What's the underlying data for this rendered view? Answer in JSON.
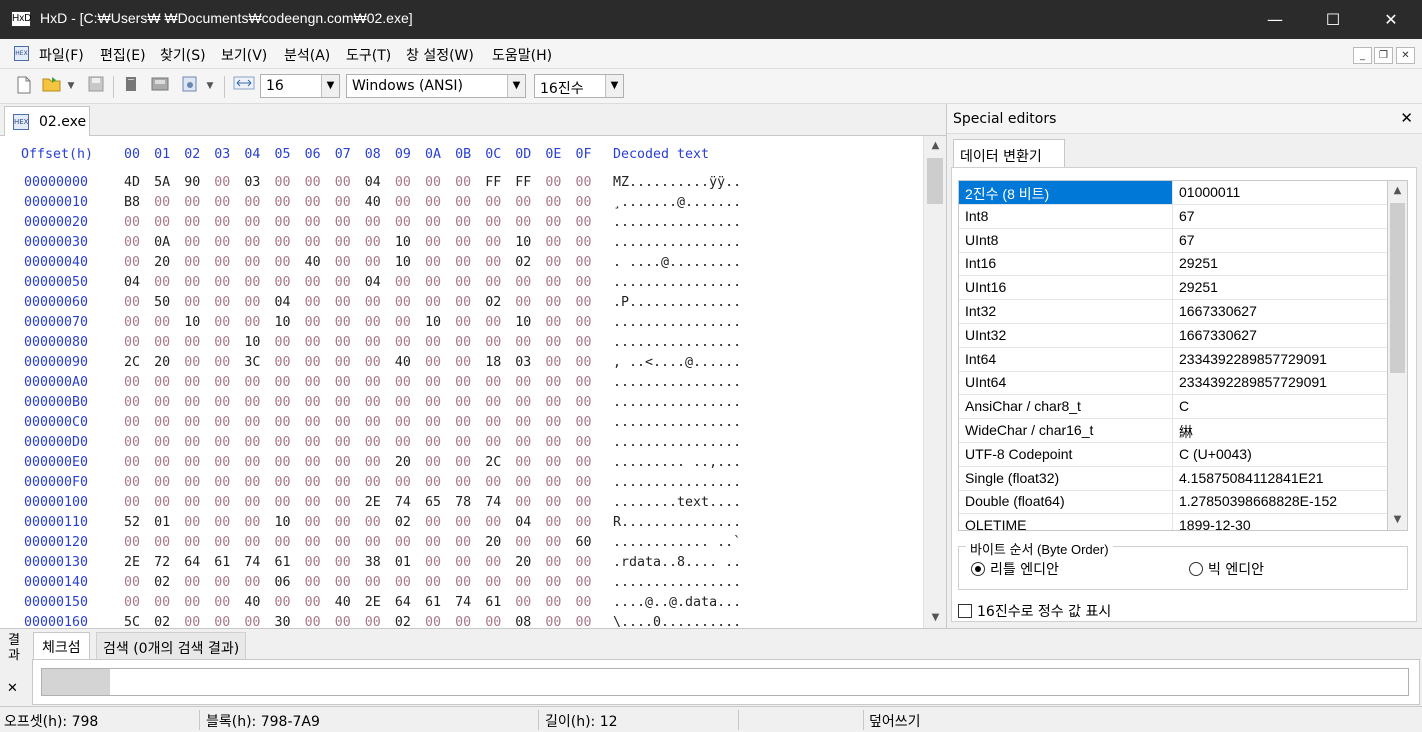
{
  "window": {
    "app_icon": "HxD",
    "title": "HxD - [C:₩Users₩     ₩Documents₩codeengn.com₩02.exe]",
    "minimize": "—",
    "maximize": "☐",
    "close": "✕"
  },
  "menu": [
    "파일(F)",
    "편집(E)",
    "찾기(S)",
    "보기(V)",
    "분석(A)",
    "도구(T)",
    "창 설정(W)",
    "도움말(H)"
  ],
  "toolbar": {
    "bytes_per_row": "16",
    "encoding": "Windows (ANSI)",
    "number_base": "16진수"
  },
  "document_tab": {
    "icon": "HEX",
    "label": "02.exe"
  },
  "hex": {
    "header_offset": "Offset(h)",
    "header_cols": [
      "00",
      "01",
      "02",
      "03",
      "04",
      "05",
      "06",
      "07",
      "08",
      "09",
      "0A",
      "0B",
      "0C",
      "0D",
      "0E",
      "0F"
    ],
    "header_text": "Decoded text",
    "rows": [
      {
        "off": "00000000",
        "bytes": [
          "4D",
          "5A",
          "90",
          "00",
          "03",
          "00",
          "00",
          "00",
          "04",
          "00",
          "00",
          "00",
          "FF",
          "FF",
          "00",
          "00"
        ],
        "text": "MZ..........ÿÿ.."
      },
      {
        "off": "00000010",
        "bytes": [
          "B8",
          "00",
          "00",
          "00",
          "00",
          "00",
          "00",
          "00",
          "40",
          "00",
          "00",
          "00",
          "00",
          "00",
          "00",
          "00"
        ],
        "text": "¸.......@......."
      },
      {
        "off": "00000020",
        "bytes": [
          "00",
          "00",
          "00",
          "00",
          "00",
          "00",
          "00",
          "00",
          "00",
          "00",
          "00",
          "00",
          "00",
          "00",
          "00",
          "00"
        ],
        "text": "................"
      },
      {
        "off": "00000030",
        "bytes": [
          "00",
          "0A",
          "00",
          "00",
          "00",
          "00",
          "00",
          "00",
          "00",
          "10",
          "00",
          "00",
          "00",
          "10",
          "00",
          "00"
        ],
        "text": "................"
      },
      {
        "off": "00000040",
        "bytes": [
          "00",
          "20",
          "00",
          "00",
          "00",
          "00",
          "40",
          "00",
          "00",
          "10",
          "00",
          "00",
          "00",
          "02",
          "00",
          "00"
        ],
        "text": ". ....@........."
      },
      {
        "off": "00000050",
        "bytes": [
          "04",
          "00",
          "00",
          "00",
          "00",
          "00",
          "00",
          "00",
          "04",
          "00",
          "00",
          "00",
          "00",
          "00",
          "00",
          "00"
        ],
        "text": "................"
      },
      {
        "off": "00000060",
        "bytes": [
          "00",
          "50",
          "00",
          "00",
          "00",
          "04",
          "00",
          "00",
          "00",
          "00",
          "00",
          "00",
          "02",
          "00",
          "00",
          "00"
        ],
        "text": ".P.............."
      },
      {
        "off": "00000070",
        "bytes": [
          "00",
          "00",
          "10",
          "00",
          "00",
          "10",
          "00",
          "00",
          "00",
          "00",
          "10",
          "00",
          "00",
          "10",
          "00",
          "00"
        ],
        "text": "................"
      },
      {
        "off": "00000080",
        "bytes": [
          "00",
          "00",
          "00",
          "00",
          "10",
          "00",
          "00",
          "00",
          "00",
          "00",
          "00",
          "00",
          "00",
          "00",
          "00",
          "00"
        ],
        "text": "................"
      },
      {
        "off": "00000090",
        "bytes": [
          "2C",
          "20",
          "00",
          "00",
          "3C",
          "00",
          "00",
          "00",
          "00",
          "40",
          "00",
          "00",
          "18",
          "03",
          "00",
          "00"
        ],
        "text": ", ..<....@......"
      },
      {
        "off": "000000A0",
        "bytes": [
          "00",
          "00",
          "00",
          "00",
          "00",
          "00",
          "00",
          "00",
          "00",
          "00",
          "00",
          "00",
          "00",
          "00",
          "00",
          "00"
        ],
        "text": "................"
      },
      {
        "off": "000000B0",
        "bytes": [
          "00",
          "00",
          "00",
          "00",
          "00",
          "00",
          "00",
          "00",
          "00",
          "00",
          "00",
          "00",
          "00",
          "00",
          "00",
          "00"
        ],
        "text": "................"
      },
      {
        "off": "000000C0",
        "bytes": [
          "00",
          "00",
          "00",
          "00",
          "00",
          "00",
          "00",
          "00",
          "00",
          "00",
          "00",
          "00",
          "00",
          "00",
          "00",
          "00"
        ],
        "text": "................"
      },
      {
        "off": "000000D0",
        "bytes": [
          "00",
          "00",
          "00",
          "00",
          "00",
          "00",
          "00",
          "00",
          "00",
          "00",
          "00",
          "00",
          "00",
          "00",
          "00",
          "00"
        ],
        "text": "................"
      },
      {
        "off": "000000E0",
        "bytes": [
          "00",
          "00",
          "00",
          "00",
          "00",
          "00",
          "00",
          "00",
          "00",
          "20",
          "00",
          "00",
          "2C",
          "00",
          "00",
          "00"
        ],
        "text": "......... ..,..."
      },
      {
        "off": "000000F0",
        "bytes": [
          "00",
          "00",
          "00",
          "00",
          "00",
          "00",
          "00",
          "00",
          "00",
          "00",
          "00",
          "00",
          "00",
          "00",
          "00",
          "00"
        ],
        "text": "................"
      },
      {
        "off": "00000100",
        "bytes": [
          "00",
          "00",
          "00",
          "00",
          "00",
          "00",
          "00",
          "00",
          "2E",
          "74",
          "65",
          "78",
          "74",
          "00",
          "00",
          "00"
        ],
        "text": "........text...."
      },
      {
        "off": "00000110",
        "bytes": [
          "52",
          "01",
          "00",
          "00",
          "00",
          "10",
          "00",
          "00",
          "00",
          "02",
          "00",
          "00",
          "00",
          "04",
          "00",
          "00"
        ],
        "text": "R..............."
      },
      {
        "off": "00000120",
        "bytes": [
          "00",
          "00",
          "00",
          "00",
          "00",
          "00",
          "00",
          "00",
          "00",
          "00",
          "00",
          "00",
          "20",
          "00",
          "00",
          "60"
        ],
        "text": "............ ..`"
      },
      {
        "off": "00000130",
        "bytes": [
          "2E",
          "72",
          "64",
          "61",
          "74",
          "61",
          "00",
          "00",
          "38",
          "01",
          "00",
          "00",
          "00",
          "20",
          "00",
          "00"
        ],
        "text": ".rdata..8.... .."
      },
      {
        "off": "00000140",
        "bytes": [
          "00",
          "02",
          "00",
          "00",
          "00",
          "06",
          "00",
          "00",
          "00",
          "00",
          "00",
          "00",
          "00",
          "00",
          "00",
          "00"
        ],
        "text": "................"
      },
      {
        "off": "00000150",
        "bytes": [
          "00",
          "00",
          "00",
          "00",
          "40",
          "00",
          "00",
          "40",
          "2E",
          "64",
          "61",
          "74",
          "61",
          "00",
          "00",
          "00"
        ],
        "text": "....@..@.data..."
      },
      {
        "off": "00000160",
        "bytes": [
          "5C",
          "02",
          "00",
          "00",
          "00",
          "30",
          "00",
          "00",
          "00",
          "02",
          "00",
          "00",
          "00",
          "08",
          "00",
          "00"
        ],
        "text": "\\....0.........."
      }
    ]
  },
  "special_editors": {
    "title": "Special editors",
    "close": "✕",
    "tab": "데이터 변환기",
    "rows": [
      {
        "k": "2진수 (8 비트)",
        "v": "01000011"
      },
      {
        "k": "Int8",
        "v": "67"
      },
      {
        "k": "UInt8",
        "v": "67"
      },
      {
        "k": "Int16",
        "v": "29251"
      },
      {
        "k": "UInt16",
        "v": "29251"
      },
      {
        "k": "Int32",
        "v": "1667330627"
      },
      {
        "k": "UInt32",
        "v": "1667330627"
      },
      {
        "k": "Int64",
        "v": "2334392289857729091"
      },
      {
        "k": "UInt64",
        "v": "2334392289857729091"
      },
      {
        "k": "AnsiChar / char8_t",
        "v": "C"
      },
      {
        "k": "WideChar / char16_t",
        "v": "綝"
      },
      {
        "k": "UTF-8 Codepoint",
        "v": "C (U+0043)"
      },
      {
        "k": "Single (float32)",
        "v": "4.15875084112841E21"
      },
      {
        "k": "Double (float64)",
        "v": "1.27850398668828E-152"
      },
      {
        "k": "OLETIME",
        "v": "1899-12-30"
      }
    ],
    "byte_order_label": "바이트 순서 (Byte Order)",
    "little_endian": "리틀 엔디안",
    "big_endian": "빅 엔디안",
    "hex_checkbox": "16진수로 정수 값 표시"
  },
  "results": {
    "side_label": "결과",
    "close": "✕",
    "tab_checksum": "체크섬",
    "tab_search": "검색 (0개의 검색 결과)",
    "progress": 0.05
  },
  "status": {
    "offset": "오프셋(h): 798",
    "block": "블록(h): 798-7A9",
    "length": "길이(h): 12",
    "mode": "덮어쓰기"
  },
  "colors": {
    "offset_blue": "#2a3fd4",
    "nonzero_byte": "#222222",
    "zero_byte": "#a87888",
    "selection": "#0078d7"
  }
}
